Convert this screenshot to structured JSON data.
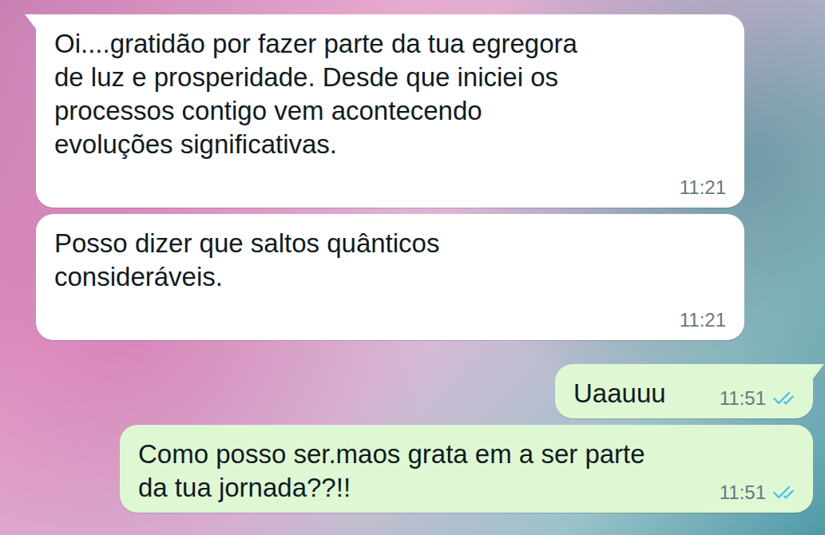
{
  "chat": {
    "messages": [
      {
        "kind": "incoming",
        "tail": true,
        "lines": [
          "Oi....gratidão por fazer parte da tua egregora",
          "de luz e prosperidade. Desde que iniciei os",
          "processos contigo vem acontecendo",
          "evoluções significativas."
        ],
        "time": "11:21"
      },
      {
        "kind": "incoming",
        "tail": false,
        "lines": [
          "Posso dizer que saltos quânticos",
          "consideráveis."
        ],
        "time": "11:21"
      },
      {
        "kind": "outgoing",
        "tail": true,
        "read": true,
        "lines": [
          "Uaauuu"
        ],
        "time": "11:51"
      },
      {
        "kind": "outgoing",
        "tail": false,
        "read": true,
        "lines": [
          "Como posso ser.maos grata em a ser parte",
          "da tua jornada??!!"
        ],
        "time": "11:51"
      }
    ]
  }
}
